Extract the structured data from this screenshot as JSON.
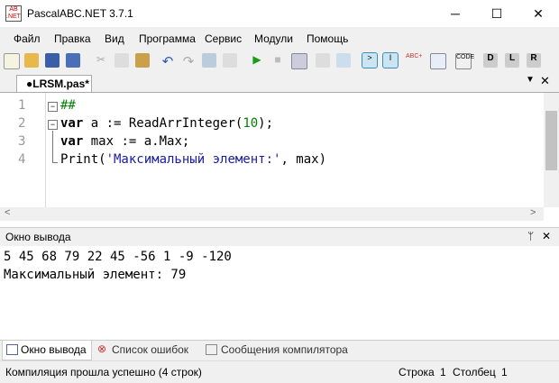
{
  "window": {
    "title": "PascalABC.NET 3.7.1",
    "logo": "ABC .NET"
  },
  "menu": [
    "Файл",
    "Правка",
    "Вид",
    "Программа",
    "Сервис",
    "Модули",
    "Помощь"
  ],
  "toolbar": [
    "new-icon",
    "open-icon",
    "save-icon",
    "save-all-icon",
    "cut-icon",
    "copy-icon",
    "paste-icon",
    "undo-icon",
    "redo-icon",
    "navigate-back-icon",
    "navigate-forward-icon",
    "run-icon",
    "stop-icon",
    "debug-icon",
    "step-into-icon",
    "step-over-icon",
    "output-window-icon",
    "immediate-window-icon",
    "spell-icon",
    "format-icon",
    "code-icon",
    "module-d-icon",
    "module-l-icon",
    "module-r-icon"
  ],
  "tab": {
    "label": "●LRSM.pas*"
  },
  "editor": {
    "line_numbers": [
      "1",
      "2",
      "3",
      "4"
    ]
  },
  "output": {
    "title": "Окно вывода",
    "lines": [
      "5 45 68 79 22 45 -56 1 -9 -120",
      "Максимальный элемент: 79"
    ]
  },
  "bottom_tabs": [
    "Окно вывода",
    "Список ошибок",
    "Сообщения компилятора"
  ],
  "status": {
    "message": "Компиляция прошла успешно (4 строк)",
    "row_label": "Строка",
    "row": "1",
    "col_label": "Столбец",
    "col": "1"
  }
}
